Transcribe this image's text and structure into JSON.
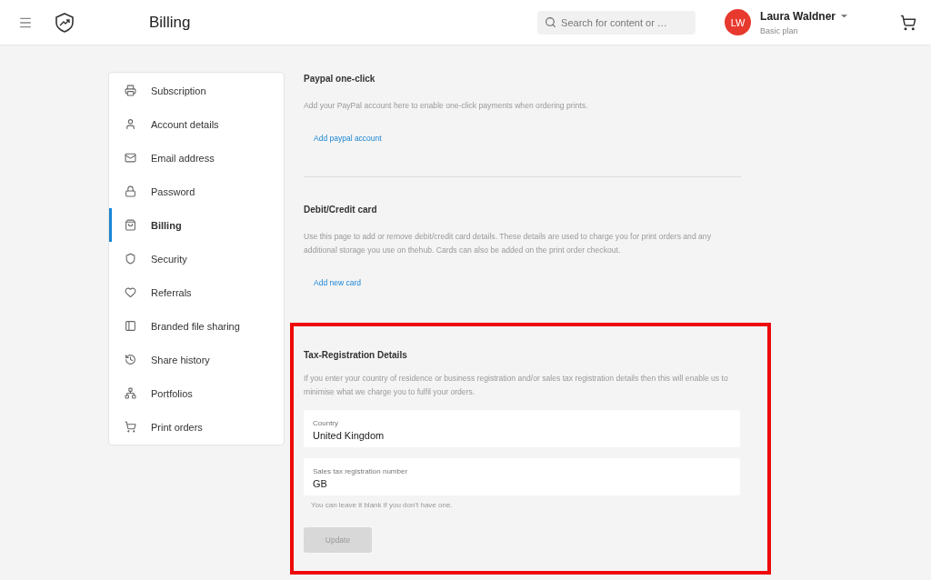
{
  "header": {
    "title": "Billing",
    "search": {
      "placeholder": "Search for content or …"
    },
    "user": {
      "initials": "LW",
      "name": "Laura Waldner",
      "plan": "Basic plan"
    }
  },
  "sidebar": {
    "items": [
      {
        "label": "Subscription",
        "selected": false
      },
      {
        "label": "Account details",
        "selected": false
      },
      {
        "label": "Email address",
        "selected": false
      },
      {
        "label": "Password",
        "selected": false
      },
      {
        "label": "Billing",
        "selected": true
      },
      {
        "label": "Security",
        "selected": false
      },
      {
        "label": "Referrals",
        "selected": false
      },
      {
        "label": "Branded file sharing",
        "selected": false
      },
      {
        "label": "Share history",
        "selected": false
      },
      {
        "label": "Portfolios",
        "selected": false
      },
      {
        "label": "Print orders",
        "selected": false
      }
    ]
  },
  "sections": [
    {
      "title": "Paypal one-click",
      "description": "Add your PayPal account here to enable one-click payments when ordering prints.",
      "link": "Add paypal account"
    },
    {
      "title": "Debit/Credit card",
      "description": "Use this page to add or remove debit/credit card details. These details are used to charge you for print orders and any additional storage you use on thehub. Cards can also be added on the print order checkout.",
      "link": "Add new card"
    }
  ],
  "tax": {
    "highlighted": true,
    "title": "Tax-Registration Details",
    "description": "If you enter your country of residence or business registration and/or sales tax registration details then this will enable us to minimise what we charge you to fulfil your orders.",
    "fields": [
      {
        "label": "Country",
        "value": "United Kingdom"
      },
      {
        "label": "Sales tax registration number",
        "value": "GB"
      }
    ],
    "hint": "You can leave it blank if you don't have one.",
    "button": {
      "label": "Update",
      "disabled": true
    }
  }
}
